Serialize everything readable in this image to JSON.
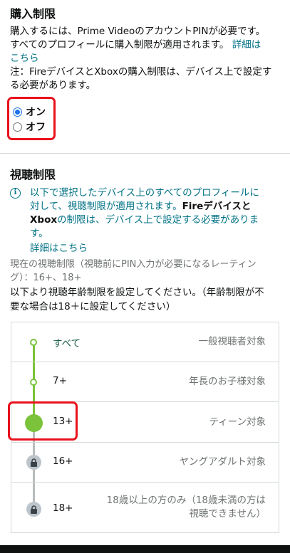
{
  "purchase": {
    "title": "購入制限",
    "desc_line1": "購入するには、Prime VideoのアカウントPINが必要です。",
    "desc_line2": "すべてのプロフィールに購入制限が適用されます。",
    "more_link_part1": "詳細は",
    "more_link_part2": "こちら",
    "note_line1": "注：FireデバイスとXboxの購入制限は、デバイス上で設定す",
    "note_line2": "る必要があります。",
    "options": [
      {
        "label": "オン",
        "checked": true
      },
      {
        "label": "オフ",
        "checked": false
      }
    ]
  },
  "viewing": {
    "title": "視聴制限",
    "info_line1": "以下で選択したデバイス上のすべてのプロフィールに",
    "info_line2_a": "対して、視聴制限が適用されます。",
    "info_line2_b": "Fireデバイス",
    "info_line2_c": "と",
    "info_line3_a": "Xbox",
    "info_line3_b": "の制限は、デバイス上で設定する必要がありま",
    "info_line4": "す。",
    "info_link": "詳細はこちら",
    "current_line1": "現在の視聴制限（視聴前にPIN入力が必要になるレーティン",
    "current_line2": "グ）：16+、18+",
    "instr_line1": "以下より視聴年齢制限を設定してください。（年齢制限が不",
    "instr_line2": "要な場合は18＋に設定してください）",
    "ratings": [
      {
        "label": "すべて",
        "desc": "一般視聴者対象",
        "state": "allowed"
      },
      {
        "label": "7+",
        "desc": "年長のお子様対象",
        "state": "allowed"
      },
      {
        "label": "13+",
        "desc": "ティーン対象",
        "state": "selected"
      },
      {
        "label": "16+",
        "desc": "ヤングアダルト対象",
        "state": "locked"
      },
      {
        "label": "18+",
        "desc_line1": "18歳以上の方のみ（18歳未満の方は",
        "desc_line2": "視聴できません）",
        "state": "locked"
      }
    ]
  },
  "colors": {
    "accent_green": "#7ac33a",
    "link_teal": "#007185",
    "highlight_red": "#e8111c",
    "radio_blue": "#1a73e8"
  }
}
